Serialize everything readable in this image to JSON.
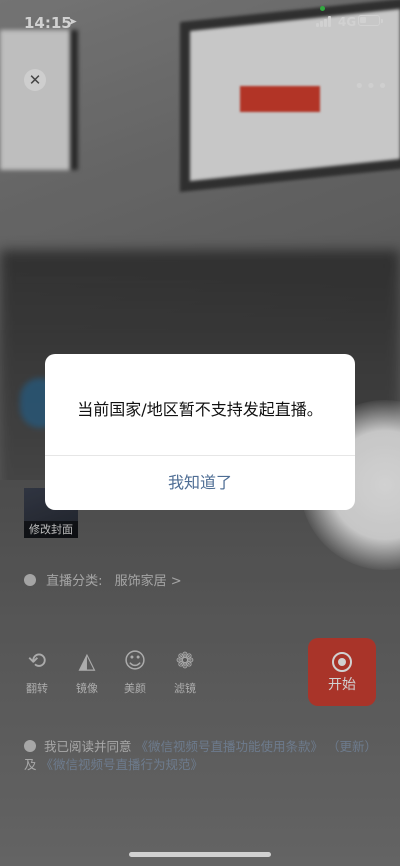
{
  "status_bar": {
    "time": "14:15",
    "network": "4G"
  },
  "dialog": {
    "message": "当前国家/地区暂不支持发起直播。",
    "confirm_label": "我知道了"
  },
  "cover": {
    "label": "修改封面"
  },
  "category": {
    "label": "直播分类:",
    "value": "服饰家居 >"
  },
  "tools": [
    {
      "label": "翻转",
      "icon": "camera-flip-icon"
    },
    {
      "label": "镜像",
      "icon": "mirror-icon"
    },
    {
      "label": "美颜",
      "icon": "beauty-icon"
    },
    {
      "label": "滤镜",
      "icon": "filter-icon"
    }
  ],
  "start_button": {
    "label": "开始"
  },
  "agreement": {
    "prefix": "我已阅读并同意",
    "link1": "《微信视频号直播功能使用条款》",
    "link1b": "（更新）",
    "and": "及",
    "link2": "《微信视频号直播行为规范》"
  },
  "colors": {
    "start_button": "#cf4033",
    "dialog_button_text": "#4e6d94"
  }
}
